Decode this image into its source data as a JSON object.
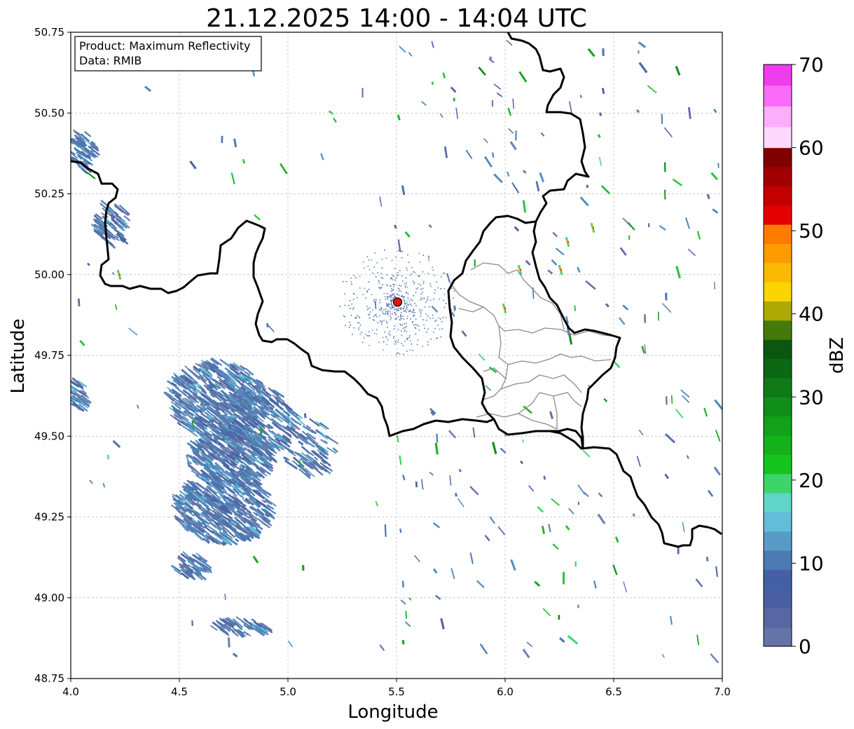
{
  "title": "21.12.2025 14:00 - 14:04 UTC",
  "info_box": {
    "line1": "Product: Maximum Reflectivity",
    "line2": "Data: RMIB"
  },
  "map": {
    "xlabel": "Longitude",
    "ylabel": "Latitude",
    "xlim": [
      4.0,
      7.0
    ],
    "ylim": [
      48.75,
      50.75
    ],
    "xticks": [
      "4.0",
      "4.5",
      "5.0",
      "5.5",
      "6.0",
      "6.5",
      "7.0"
    ],
    "yticks": [
      "48.75",
      "49.00",
      "49.25",
      "49.50",
      "49.75",
      "50.00",
      "50.25",
      "50.50",
      "50.75"
    ],
    "grid": true,
    "radar_site": {
      "lon": 5.505,
      "lat": 49.915,
      "color": "#e81010"
    }
  },
  "colorbar": {
    "label": "dBZ",
    "range": [
      0,
      70
    ],
    "ticks": [
      "0",
      "10",
      "20",
      "30",
      "40",
      "50",
      "60",
      "70"
    ],
    "colors": [
      "#6573a8",
      "#5866a4",
      "#4a5ea3",
      "#4460a5",
      "#4c7ab2",
      "#579cc6",
      "#61bdd9",
      "#5fd6c9",
      "#3dd46c",
      "#15c41d",
      "#13b21b",
      "#12a11a",
      "#118e18",
      "#0f7b17",
      "#0d6813",
      "#0c5710",
      "#457a0a",
      "#adaa06",
      "#fad501",
      "#fbb903",
      "#fd9b00",
      "#fe7b00",
      "#e40000",
      "#c30000",
      "#a20000",
      "#800000",
      "#fed9fe",
      "#fcaefc",
      "#f96cf7",
      "#ef3ded"
    ]
  },
  "borders_color": "#000000",
  "inner_borders_color": "#8a8a8a"
}
